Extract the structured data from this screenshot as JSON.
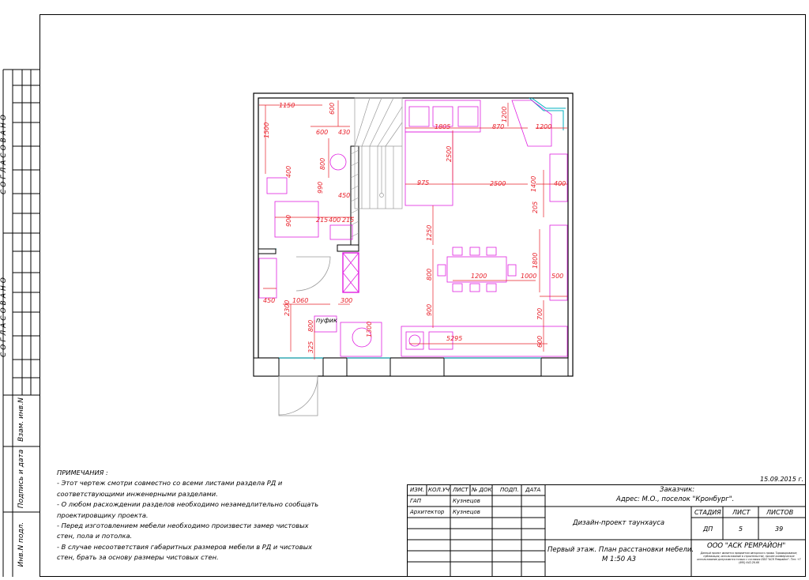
{
  "side_stamp": {
    "agreed_1": "СОГЛАСОВАНО",
    "agreed_2": "СОГЛАСОВАНО",
    "inv_replace": "Взам. инв.N",
    "sign_date": "Подпись и дата",
    "inv_orig": "Инв.N подл."
  },
  "plan": {
    "dims": [
      "1150",
      "600",
      "1500",
      "600",
      "430",
      "800",
      "400",
      "1805",
      "870",
      "1200",
      "1200",
      "2500",
      "975",
      "2500",
      "1400",
      "400",
      "450",
      "990",
      "900",
      "215",
      "400",
      "215",
      "205",
      "1250",
      "800",
      "1200",
      "1000",
      "500",
      "1800",
      "450",
      "1060",
      "300",
      "2300",
      "800",
      "900",
      "700",
      "325",
      "1300",
      "5295",
      "600"
    ],
    "labels": {
      "pouf": "пуфик"
    }
  },
  "notes": {
    "heading": "ПРИМЕЧАНИЯ :",
    "lines": [
      "- Этот чертеж смотри совместно со всеми листами раздела РД и",
      "соответствующими инженерными разделами.",
      "- О любом расхождении разделов необходимо незамедлительно сообщать",
      "проектировщику проекта.",
      "- Перед изготовлением мебели необходимо произвести замер чистовых",
      "стен, пола и потолка.",
      "- В случае несоответствия габаритных размеров мебели в РД и чистовых",
      "стен, брать за основу размеры чистовых стен."
    ]
  },
  "title_block": {
    "date": "15.09.2015 г.",
    "headers": [
      "ИЗМ.",
      "КОЛ.УЧ",
      "ЛИСТ",
      "№ ДОК",
      "ПОДП.",
      "ДАТА"
    ],
    "rows": [
      {
        "role": "ГАП",
        "name": "Кузнецов"
      },
      {
        "role": "Архитектор",
        "name": "Кузнецов"
      }
    ],
    "customer": "Заказчик:",
    "address": "Адрес: М.О., поселок \"Кронбург\".",
    "project": "Дизайн-проект таунхауса",
    "sheet_title_1": "Первый этаж. План расстановки мебели.",
    "sheet_title_2": "М 1:50 А3",
    "stage_h": "СТАДИЯ",
    "sheet_h": "ЛИСТ",
    "sheets_h": "ЛИСТОВ",
    "stage": "ДП",
    "sheet": "5",
    "sheets": "39",
    "company": "ООО \"АСК РЕМРАЙОН\"",
    "copyright": "Данный проект является предметом авторского права. Тиражирование, публикация, использование в строительстве, прочее коммерческое использование допускаются только с согласия ООО \"АСК Ремрайон\". Тел: +7 (495) 642-26-66"
  },
  "colors": {
    "dim": "#e8202a",
    "furniture": "#e020e0",
    "wall": "#000000",
    "window": "#00b0c0",
    "grey": "#9a9a9a"
  }
}
